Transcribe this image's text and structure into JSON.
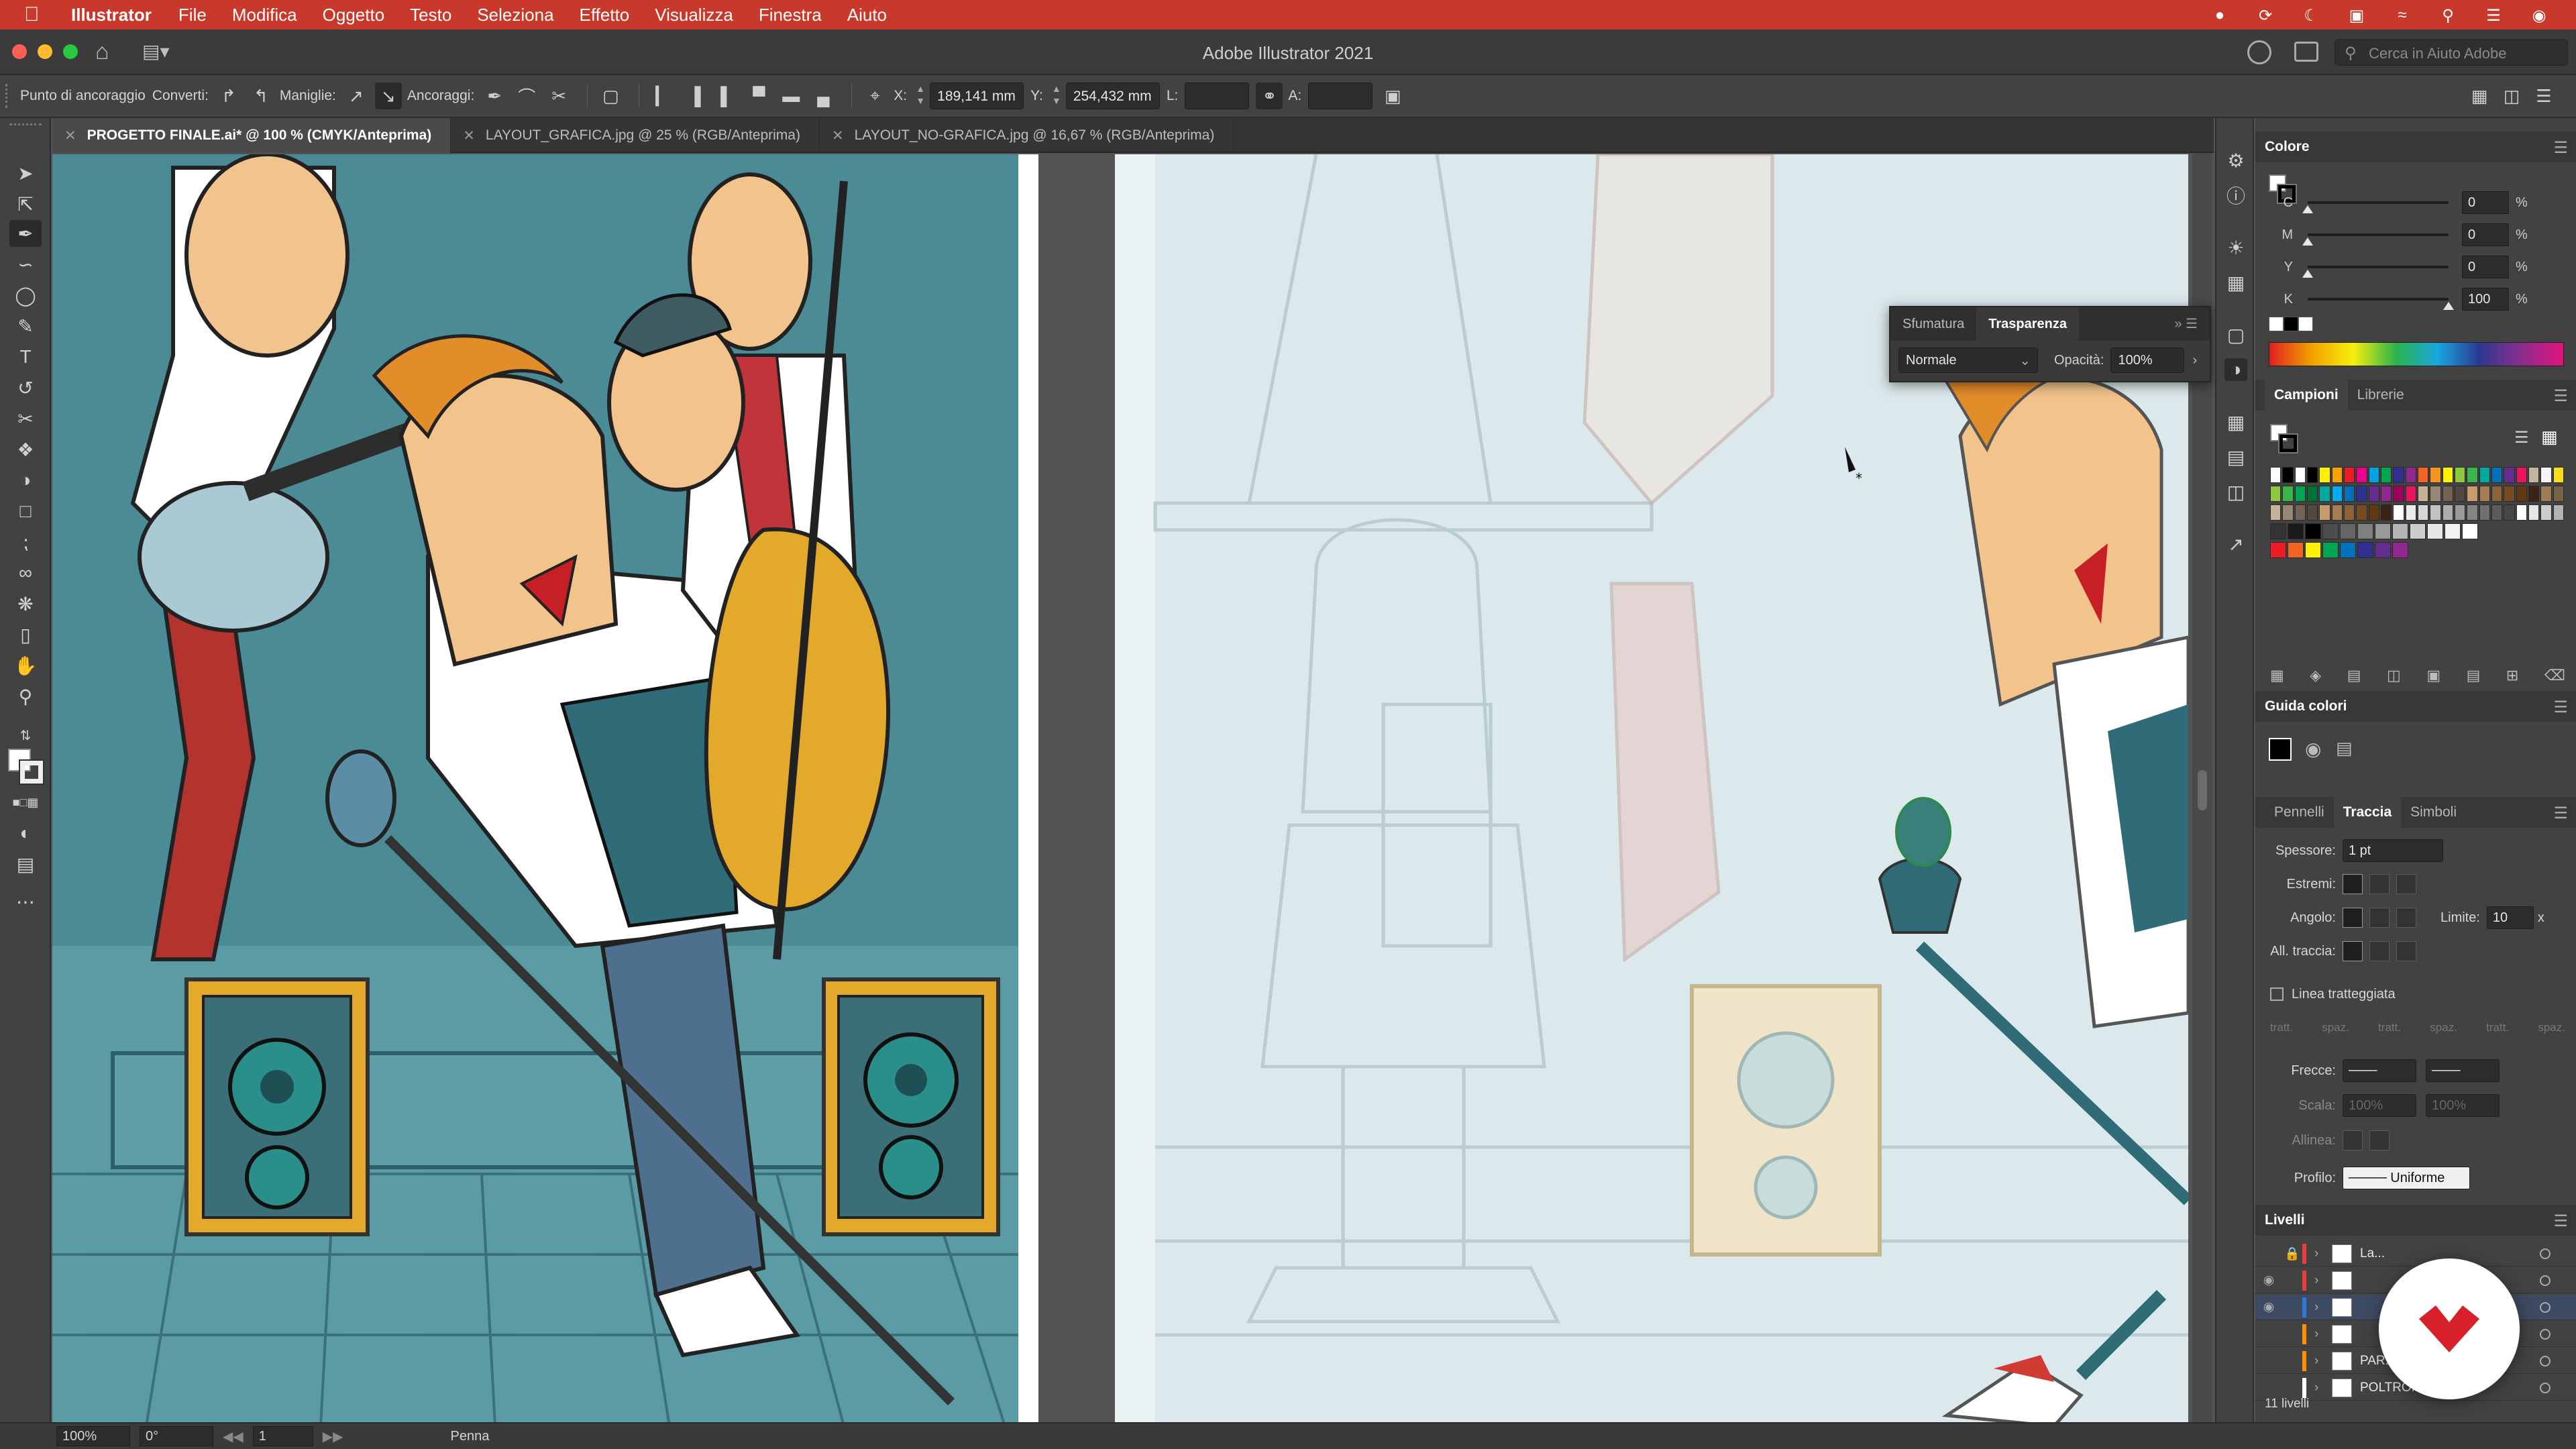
{
  "menubar": {
    "app_name": "Illustrator",
    "items": [
      "File",
      "Modifica",
      "Oggetto",
      "Testo",
      "Seleziona",
      "Effetto",
      "Visualizza",
      "Finestra",
      "Aiuto"
    ]
  },
  "titlebar": {
    "title": "Adobe Illustrator 2021",
    "help_search_placeholder": "Cerca in Aiuto Adobe"
  },
  "controlbar": {
    "anchor_label": "Punto di ancoraggio",
    "convert_label": "Converti:",
    "handles_label": "Maniglie:",
    "anchors_label": "Ancoraggi:",
    "x_label": "X:",
    "x_value": "189,141 mm",
    "y_label": "Y:",
    "y_value": "254,432 mm",
    "l_label": "L:",
    "a_label": "A:"
  },
  "tabs": [
    {
      "label": "PROGETTO FINALE.ai* @ 100 % (CMYK/Anteprima)",
      "active": true
    },
    {
      "label": "LAYOUT_GRAFICA.jpg @ 25 % (RGB/Anteprima)",
      "active": false
    },
    {
      "label": "LAYOUT_NO-GRAFICA.jpg @ 16,67 % (RGB/Anteprima)",
      "active": false
    }
  ],
  "transparency_panel": {
    "tab_gradient": "Sfumatura",
    "tab_transparency": "Trasparenza",
    "blend_mode": "Normale",
    "opacity_label": "Opacità:",
    "opacity_value": "100%"
  },
  "color_panel": {
    "title": "Colore",
    "channels": [
      {
        "letter": "C",
        "value": "0",
        "level": 0
      },
      {
        "letter": "M",
        "value": "0",
        "level": 0
      },
      {
        "letter": "Y",
        "value": "0",
        "level": 0
      },
      {
        "letter": "K",
        "value": "100",
        "level": 100
      }
    ],
    "percent": "%"
  },
  "swatches_panel": {
    "tab_swatches": "Campioni",
    "tab_libraries": "Librerie",
    "rows": [
      [
        "#ffffff",
        "#000000",
        "#ffffff",
        "#000000",
        "#ffef00",
        "#f6a300",
        "#ed1c24",
        "#ec008c",
        "#00a2e2",
        "#00a651",
        "#2e3192",
        "#92278f",
        "#f26522",
        "#f7941d",
        "#fff200",
        "#8dc63f",
        "#39b54a",
        "#00a99d",
        "#0072bc",
        "#662d91",
        "#ed145b",
        "#c2b59b",
        "#f5f5f5",
        "#ffde17"
      ],
      [
        "#8dc63f",
        "#39b54a",
        "#00a651",
        "#007236",
        "#00a99d",
        "#00aeef",
        "#0072bc",
        "#2e3192",
        "#662d91",
        "#92278f",
        "#9e005d",
        "#ed145b",
        "#c7b299",
        "#998675",
        "#736357",
        "#534741",
        "#c69c6d",
        "#a67c52",
        "#8c6239",
        "#754c24",
        "#603913",
        "#3c2415",
        "#9e7c54",
        "#786247"
      ],
      [
        "#c7b299",
        "#998675",
        "#736357",
        "#534741",
        "#c69c6d",
        "#a67c52",
        "#8c6239",
        "#754c24",
        "#603913",
        "#3c2415",
        "#ffffff",
        "#ebebeb",
        "#d6d6d6",
        "#c2c2c2",
        "#adadad",
        "#999999",
        "#858585",
        "#707070",
        "#5c5c5c",
        "#474747",
        "#ffffff",
        "#e6e6e6",
        "#cdcdcd",
        "#b3b3b3"
      ],
      [
        "#333333",
        "#1a1a1a",
        "#000000",
        "#4d4d4d",
        "#666666",
        "#808080",
        "#999999",
        "#b3b3b3",
        "#cccccc",
        "#e6e6e6",
        "#f2f2f2",
        "#ffffff"
      ],
      [
        "#ed1c24",
        "#f26522",
        "#fff200",
        "#00a651",
        "#0072bc",
        "#2e3192",
        "#662d91",
        "#92278f"
      ]
    ]
  },
  "color_guide": {
    "title": "Guida colori"
  },
  "stroke_panel": {
    "tab_brushes": "Pennelli",
    "tab_stroke": "Traccia",
    "tab_symbols": "Simboli",
    "weight_label": "Spessore:",
    "weight_value": "1 pt",
    "caps_label": "Estremi:",
    "corner_label": "Angolo:",
    "limit_label": "Limite:",
    "limit_value": "10",
    "limit_unit": "x",
    "align_label": "All. traccia:",
    "dashed_label": "Linea tratteggiata",
    "dash_labels": [
      "tratt.",
      "spaz.",
      "tratt.",
      "spaz.",
      "tratt.",
      "spaz."
    ],
    "arrows_label": "Frecce:",
    "scale_label": "Scala:",
    "scale_a": "100%",
    "scale_b": "100%",
    "align2_label": "Allinea:",
    "profile_label": "Profilo:",
    "profile_value": "Uniforme"
  },
  "layers_panel": {
    "title": "Livelli",
    "rows": [
      {
        "name": "La...",
        "color": "#ee3b3b",
        "visible": false,
        "locked": true
      },
      {
        "name": "",
        "color": "#ee3b3b",
        "visible": true,
        "locked": false
      },
      {
        "name": "",
        "color": "#2f79d6",
        "visible": true,
        "locked": false
      },
      {
        "name": "",
        "color": "#ff8f00",
        "visible": false,
        "locked": false
      },
      {
        "name": "PAR...",
        "color": "#ff8f00",
        "visible": false,
        "locked": false
      },
      {
        "name": "POLTRONA 2",
        "color": "#ffffff",
        "visible": false,
        "locked": false
      }
    ],
    "count_label": "11 livelli"
  },
  "statusbar": {
    "zoom": "100%",
    "rotation": "0°",
    "artboard": "1",
    "tool": "Penna"
  },
  "icons": {
    "apple": "apple-icon",
    "home": "home-icon",
    "workspace": "workspace-icon",
    "pen": "pen-tool-icon"
  }
}
